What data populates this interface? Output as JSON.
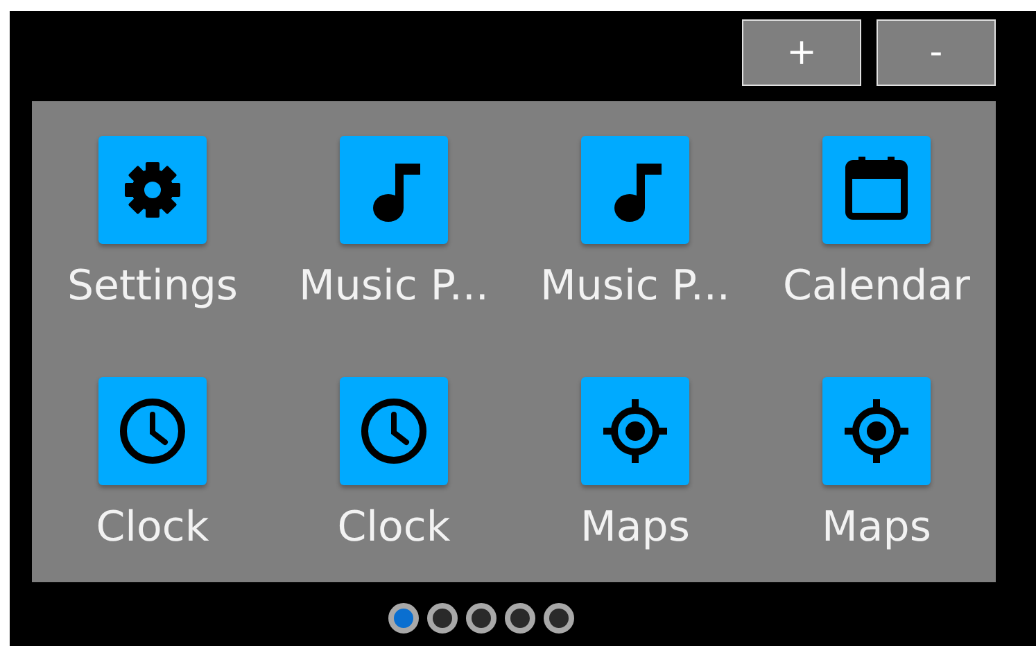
{
  "buttons": [
    {
      "label": "+"
    },
    {
      "label": "-"
    }
  ],
  "apps": [
    {
      "kind": "gear",
      "label": "Settings"
    },
    {
      "kind": "note",
      "label": "Music P..."
    },
    {
      "kind": "note",
      "label": "Music P..."
    },
    {
      "kind": "calendar",
      "label": "Calendar"
    },
    {
      "kind": "clock",
      "label": "Clock"
    },
    {
      "kind": "clock",
      "label": "Clock"
    },
    {
      "kind": "target",
      "label": "Maps"
    },
    {
      "kind": "target",
      "label": "Maps"
    }
  ],
  "pages": [
    {
      "selected": true
    },
    {
      "selected": false
    },
    {
      "selected": false
    },
    {
      "selected": false
    },
    {
      "selected": false
    }
  ]
}
